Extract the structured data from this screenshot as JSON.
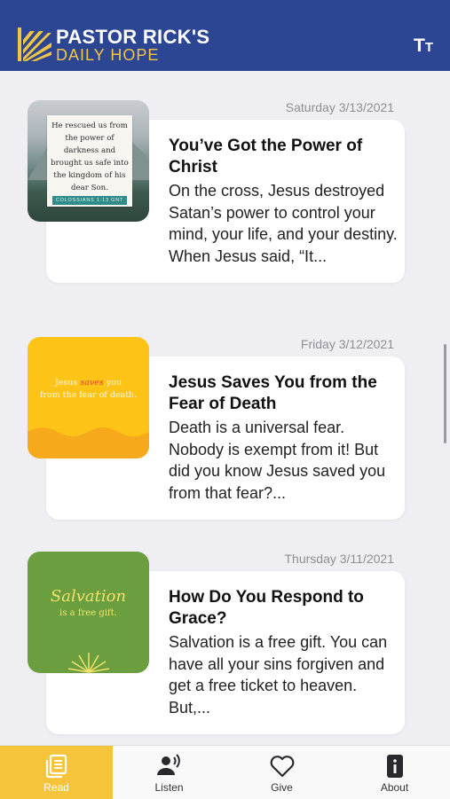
{
  "header": {
    "brand_line1": "PASTOR RICK'S",
    "brand_line2": "DAILY HOPE",
    "text_size_glyph_big": "T",
    "text_size_glyph_small": "T"
  },
  "devotionals": [
    {
      "date": "Saturday 3/13/2021",
      "title": "You’ve Got the Power of Christ",
      "excerpt": "On the cross, Jesus destroyed Satan’s power to control your mind, your life, and your destiny. When Jesus said, “It...",
      "thumbnail": {
        "verse": "He rescued us from the power of darkness and brought us safe into the kingdom of his dear Son.",
        "reference": "COLOSSIANS 1:13 GNT"
      }
    },
    {
      "date": "Friday 3/12/2021",
      "title": "Jesus Saves You from the Fear of Death",
      "excerpt": "Death is a universal fear. Nobody is exempt from it! But did you know Jesus saved you from that fear?...",
      "thumbnail": {
        "word1": "Jesus",
        "word2": "saves",
        "word3": "you",
        "line2": "from the fear of death."
      }
    },
    {
      "date": "Thursday 3/11/2021",
      "title": "How Do You Respond to Grace?",
      "excerpt": "Salvation is a free gift. You can have all your sins forgiven and get a free ticket to heaven. But,...",
      "thumbnail": {
        "script": "Salvation",
        "sub": "is a free gift."
      }
    }
  ],
  "tabs": [
    {
      "label": "Read",
      "icon": "book-icon",
      "active": true
    },
    {
      "label": "Listen",
      "icon": "speaker-person-icon",
      "active": false
    },
    {
      "label": "Give",
      "icon": "heart-icon",
      "active": false
    },
    {
      "label": "About",
      "icon": "info-phone-icon",
      "active": false
    }
  ],
  "colors": {
    "header_bg": "#2c4694",
    "brand_yellow": "#f4c542",
    "tab_active": "#f6c43a",
    "page_bg": "#eeeef3"
  }
}
